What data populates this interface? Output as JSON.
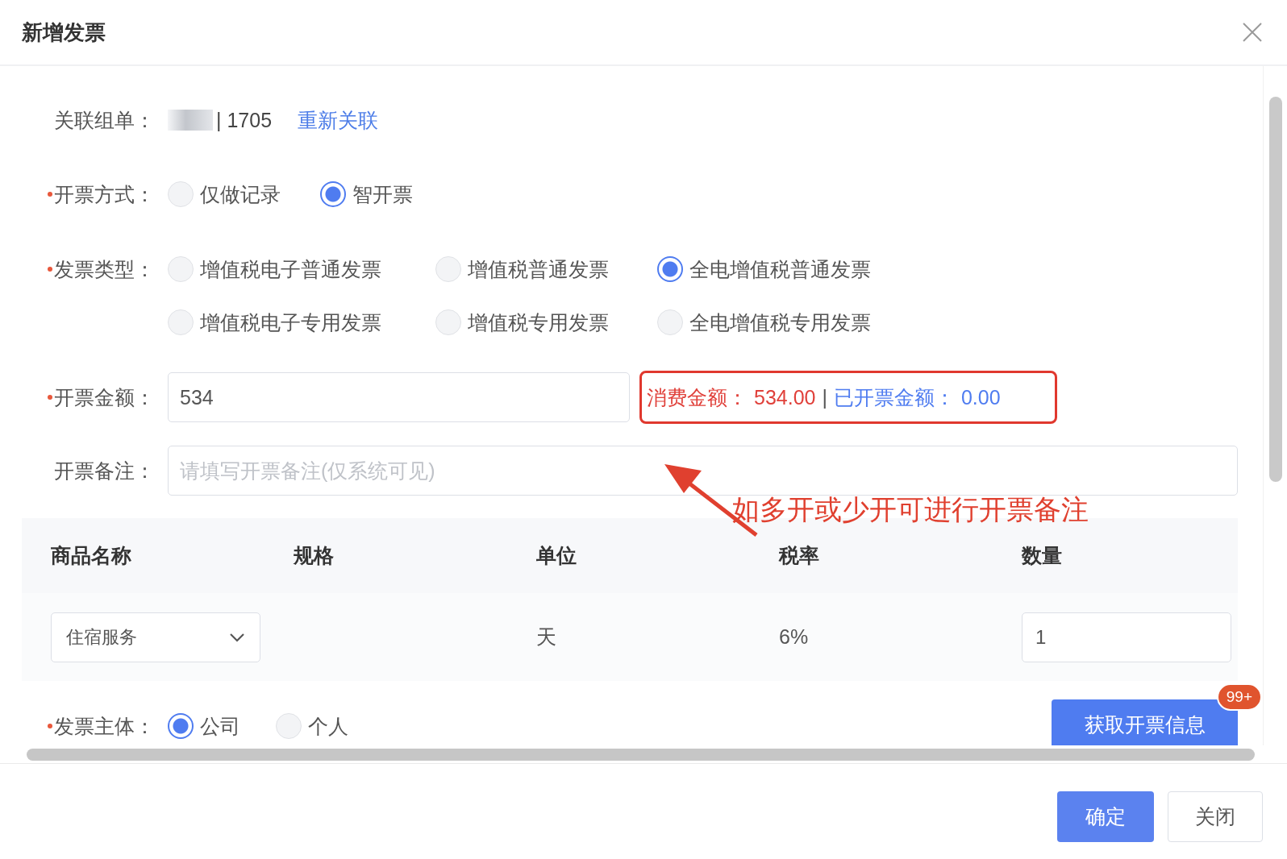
{
  "dialog": {
    "title": "新增发票"
  },
  "linked_order": {
    "label": "关联组单：",
    "value": "| 1705",
    "link": "重新关联"
  },
  "invoice_method": {
    "label": "开票方式：",
    "required": true,
    "options": [
      {
        "label": "仅做记录",
        "selected": false
      },
      {
        "label": "智开票",
        "selected": true
      }
    ]
  },
  "invoice_type": {
    "label": "发票类型：",
    "required": true,
    "options": [
      {
        "label": "增值税电子普通发票",
        "selected": false
      },
      {
        "label": "增值税普通发票",
        "selected": false
      },
      {
        "label": "全电增值税普通发票",
        "selected": true
      },
      {
        "label": "增值税电子专用发票",
        "selected": false
      },
      {
        "label": "增值税专用发票",
        "selected": false
      },
      {
        "label": "全电增值税专用发票",
        "selected": false
      }
    ]
  },
  "amount": {
    "label": "开票金额：",
    "required": true,
    "value": "534",
    "summary": {
      "consumed_label": "消费金额：",
      "consumed": "534.00",
      "separator": "|",
      "invoiced_label": "已开票金额：",
      "invoiced": "0.00"
    }
  },
  "remark": {
    "label": "开票备注：",
    "placeholder": "请填写开票备注(仅系统可见)"
  },
  "annotation": "如多开或少开可进行开票备注",
  "table": {
    "columns": [
      "商品名称",
      "规格",
      "单位",
      "税率",
      "数量"
    ],
    "rows": [
      {
        "product": "住宿服务",
        "unit": "天",
        "tax_rate": "6%",
        "quantity": "1"
      }
    ]
  },
  "invoice_subject": {
    "label": "发票主体：",
    "required": true,
    "options": [
      {
        "label": "公司",
        "selected": true
      },
      {
        "label": "个人",
        "selected": false
      }
    ]
  },
  "fetch_button": {
    "label": "获取开票信息",
    "badge": "99+"
  },
  "footer_buttons": [
    {
      "label": "确定",
      "kind": "primary"
    },
    {
      "label": "关闭",
      "kind": "default"
    }
  ]
}
